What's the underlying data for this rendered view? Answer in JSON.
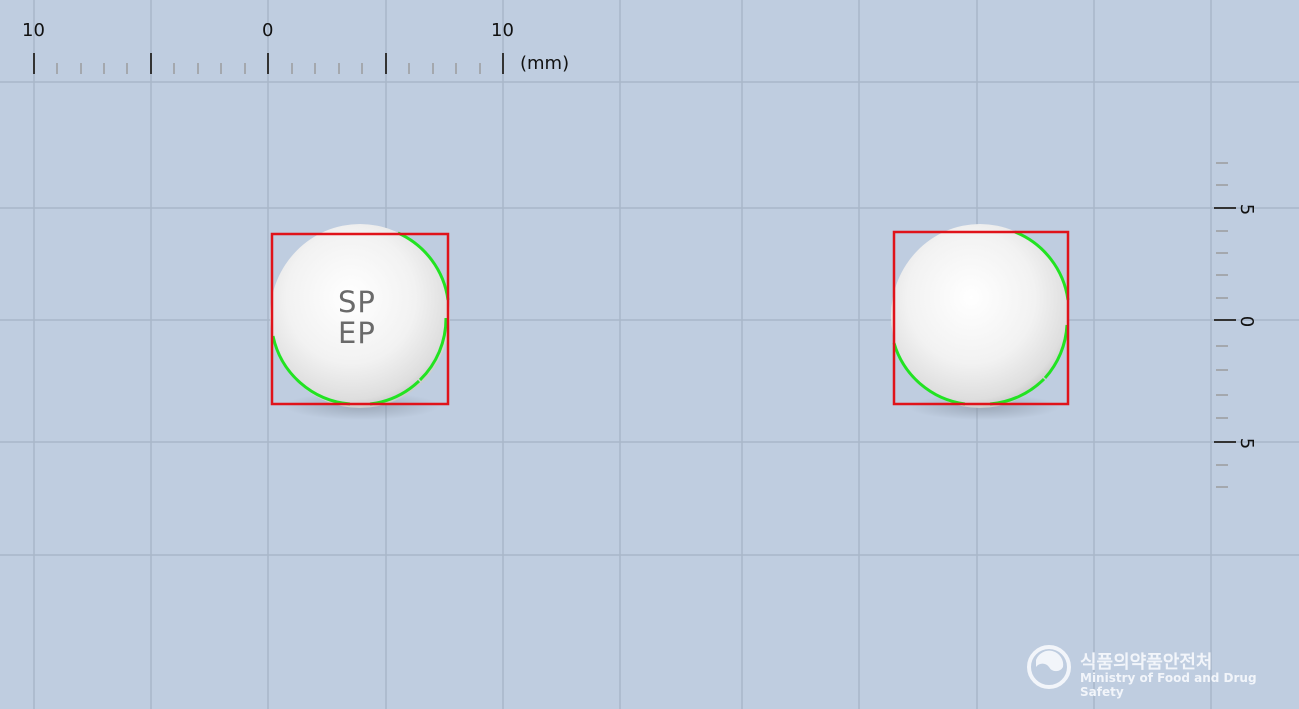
{
  "ruler_top": {
    "labels": [
      "10",
      "0",
      "10"
    ],
    "unit": "(mm)"
  },
  "ruler_right": {
    "labels": [
      "5",
      "0",
      "5"
    ]
  },
  "pill_front": {
    "imprint_line1": "SP",
    "imprint_line2": "EP"
  },
  "logo": {
    "korean": "식품의약품안전처",
    "english": "Ministry of Food and Drug Safety"
  },
  "colors": {
    "background": "#bfcde0",
    "grid": "#a7b5c7",
    "box": "#e0131a",
    "contour": "#22e322",
    "pill": "#f3f3f3"
  }
}
